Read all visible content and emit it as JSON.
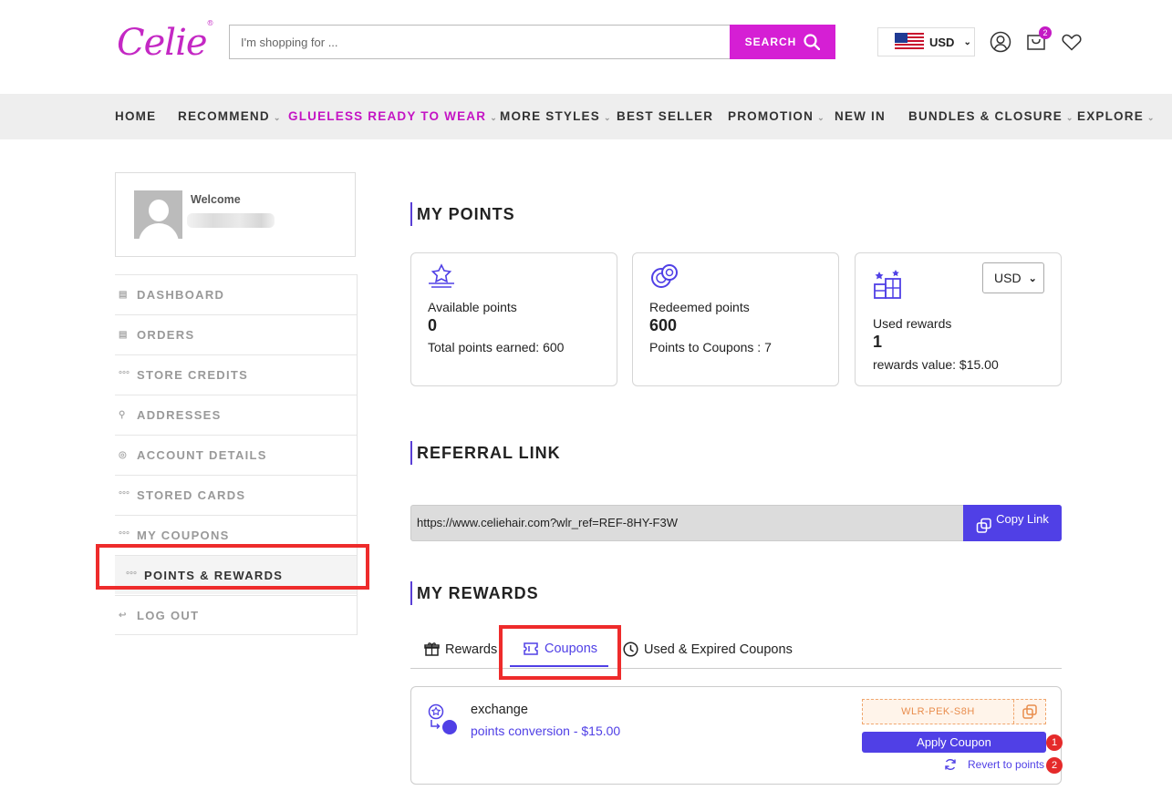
{
  "header": {
    "logo_text": "Celie",
    "logo_mark": "®",
    "search_placeholder": "I'm shopping for ...",
    "search_button": "SEARCH",
    "currency": "USD",
    "cart_count": "2"
  },
  "nav": [
    {
      "label": "HOME",
      "caret": false
    },
    {
      "label": "RECOMMEND",
      "caret": true
    },
    {
      "label": "GLUELESS READY TO WEAR",
      "caret": true,
      "active": true
    },
    {
      "label": "MORE STYLES",
      "caret": true
    },
    {
      "label": "BEST SELLER",
      "caret": false
    },
    {
      "label": "PROMOTION",
      "caret": true
    },
    {
      "label": "NEW IN",
      "caret": false
    },
    {
      "label": "BUNDLES & CLOSURE",
      "caret": true
    },
    {
      "label": "EXPLORE",
      "caret": true
    }
  ],
  "sidebar": {
    "welcome": "Welcome",
    "items": [
      {
        "label": "DASHBOARD",
        "icon": "dashboard-icon"
      },
      {
        "label": "ORDERS",
        "icon": "orders-icon"
      },
      {
        "label": "STORE CREDITS",
        "icon": "dots-icon"
      },
      {
        "label": "ADDRESSES",
        "icon": "location-icon"
      },
      {
        "label": "ACCOUNT DETAILS",
        "icon": "account-icon"
      },
      {
        "label": "STORED CARDS",
        "icon": "dots-icon"
      },
      {
        "label": "MY COUPONS",
        "icon": "dots-icon"
      },
      {
        "label": "POINTS & REWARDS",
        "icon": "dots-icon",
        "active": true
      },
      {
        "label": "LOG OUT",
        "icon": "logout-icon"
      }
    ]
  },
  "points": {
    "title": "MY POINTS",
    "available": {
      "label": "Available points",
      "value": "0",
      "sub": "Total points earned: 600"
    },
    "redeemed": {
      "label": "Redeemed points",
      "value": "600",
      "sub": "Points to Coupons : 7"
    },
    "used": {
      "label": "Used rewards",
      "value": "1",
      "sub": "rewards value: $15.00",
      "currency": "USD"
    }
  },
  "referral": {
    "title": "REFERRAL LINK",
    "url": "https://www.celiehair.com?wlr_ref=REF-8HY-F3W",
    "copy_label": "Copy Link"
  },
  "rewards": {
    "title": "MY REWARDS",
    "tabs": [
      "Rewards",
      "Coupons",
      "Used & Expired Coupons"
    ],
    "coupon": {
      "name": "exchange",
      "desc": "points conversion - $15.00",
      "code": "WLR-PEK-S8H",
      "apply_label": "Apply Coupon",
      "revert_label": "Revert to points",
      "marker1": "1",
      "marker2": "2"
    }
  },
  "colors": {
    "brand": "#d51fd4",
    "accent": "#5040e6",
    "highlight": "#ee2b2b"
  }
}
